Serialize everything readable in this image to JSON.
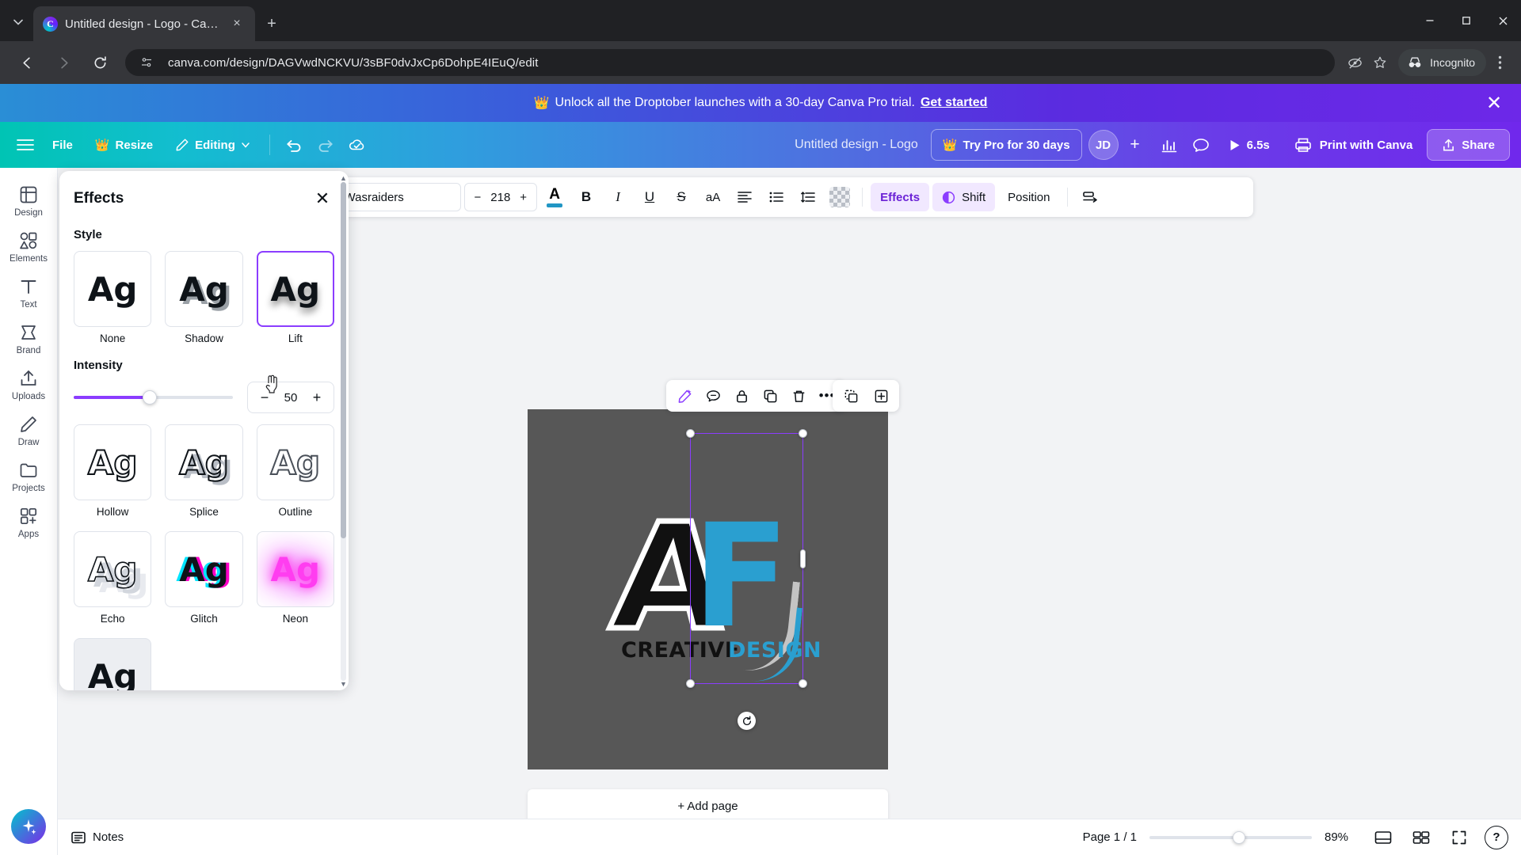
{
  "browser": {
    "tab": {
      "title": "Untitled design - Logo - Canva",
      "favicon": "canva-icon",
      "close": "×"
    },
    "new_tab": "+",
    "url": "canva.com/design/DAGVwdNCKVU/3sBF0dvJxCp6DohpE4IEuQ/edit",
    "profile_mode": "Incognito",
    "window": {
      "minimize": "─",
      "maximize": "□",
      "close": "✕"
    }
  },
  "promo": {
    "crown": "👑",
    "text": "Unlock all the Droptober launches with a 30-day Canva Pro trial.",
    "link": "Get started",
    "close": "✕"
  },
  "topbar": {
    "menu": "hamburger-icon",
    "file": "File",
    "resize": "Resize",
    "editing": "Editing",
    "undo": "undo-icon",
    "redo": "redo-icon",
    "cloud": "cloud-saved-icon",
    "doc_title": "Untitled design - Logo",
    "try_pro": "Try Pro for 30 days",
    "avatar_initials": "JD",
    "avatar_add": "+",
    "insights": "insights-icon",
    "comment": "comment-icon",
    "present_time": "6.5s",
    "print": "Print with Canva",
    "share": "Share"
  },
  "rail": {
    "items": [
      {
        "label": "Design",
        "icon": "design-icon"
      },
      {
        "label": "Elements",
        "icon": "elements-icon"
      },
      {
        "label": "Text",
        "icon": "text-icon"
      },
      {
        "label": "Brand",
        "icon": "brand-icon"
      },
      {
        "label": "Uploads",
        "icon": "uploads-icon"
      },
      {
        "label": "Draw",
        "icon": "draw-icon"
      },
      {
        "label": "Projects",
        "icon": "projects-icon"
      },
      {
        "label": "Apps",
        "icon": "apps-icon"
      }
    ],
    "magic": "magic-sparkle-icon"
  },
  "panel": {
    "title": "Effects",
    "close": "✕",
    "style_section": "Style",
    "styles": [
      {
        "name": "None",
        "sample": "Ag",
        "selected": false,
        "class": "t-none"
      },
      {
        "name": "Shadow",
        "sample": "Ag",
        "selected": false,
        "class": "t-shadow"
      },
      {
        "name": "Lift",
        "sample": "Ag",
        "selected": true,
        "class": "t-lift"
      },
      {
        "name": "Hollow",
        "sample": "Ag",
        "selected": false,
        "class": "t-hollow"
      },
      {
        "name": "Splice",
        "sample": "Ag",
        "selected": false,
        "class": "t-splice"
      },
      {
        "name": "Outline",
        "sample": "Ag",
        "selected": false,
        "class": "t-outline"
      },
      {
        "name": "Echo",
        "sample": "Ag",
        "selected": false,
        "class": "t-echo"
      },
      {
        "name": "Glitch",
        "sample": "Ag",
        "selected": false,
        "class": "t-glitch"
      },
      {
        "name": "Neon",
        "sample": "Ag",
        "selected": false,
        "class": "t-neon"
      },
      {
        "name": "",
        "sample": "Ag",
        "selected": false,
        "class": "t-bg"
      }
    ],
    "intensity_label": "Intensity",
    "intensity_value": "50",
    "intensity_minus": "−",
    "intensity_plus": "+",
    "accent_color": "#8b3dff"
  },
  "text_toolbar": {
    "font": "Wasraiders",
    "size": "218",
    "size_minus": "−",
    "size_plus": "+",
    "text_color": "A",
    "text_color_hex": "#2196c4",
    "bold": "B",
    "italic": "I",
    "underline": "U",
    "strike": "S",
    "case": "aA",
    "align": "align-icon",
    "list": "list-icon",
    "spacing": "line-spacing-icon",
    "transparency": "transparency-icon",
    "effects": "Effects",
    "shift": "Shift",
    "position": "Position",
    "animate": "animate-icon"
  },
  "element_toolbar": {
    "edit": "magic-edit-icon",
    "comment": "comment-icon",
    "lock": "lock-icon",
    "duplicate": "duplicate-icon",
    "delete": "trash-icon",
    "more": "•••",
    "copy_style": "copy-style-icon",
    "add": "add-icon"
  },
  "canvas": {
    "logo": {
      "letter_a": "A",
      "letter_f": "F",
      "word_creative": "CREATIVE",
      "word_design": "DESIGN",
      "bg_color": "#575757",
      "accent_color": "#2a9fd0"
    },
    "rotate": "rotate-icon",
    "add_page": "+ Add page"
  },
  "bottombar": {
    "notes": "Notes",
    "page_label": "Page 1 / 1",
    "zoom": "89%",
    "grid_view": "grid-view-icon",
    "pages_view": "pages-view-icon",
    "fullscreen": "fullscreen-icon",
    "help": "?"
  }
}
